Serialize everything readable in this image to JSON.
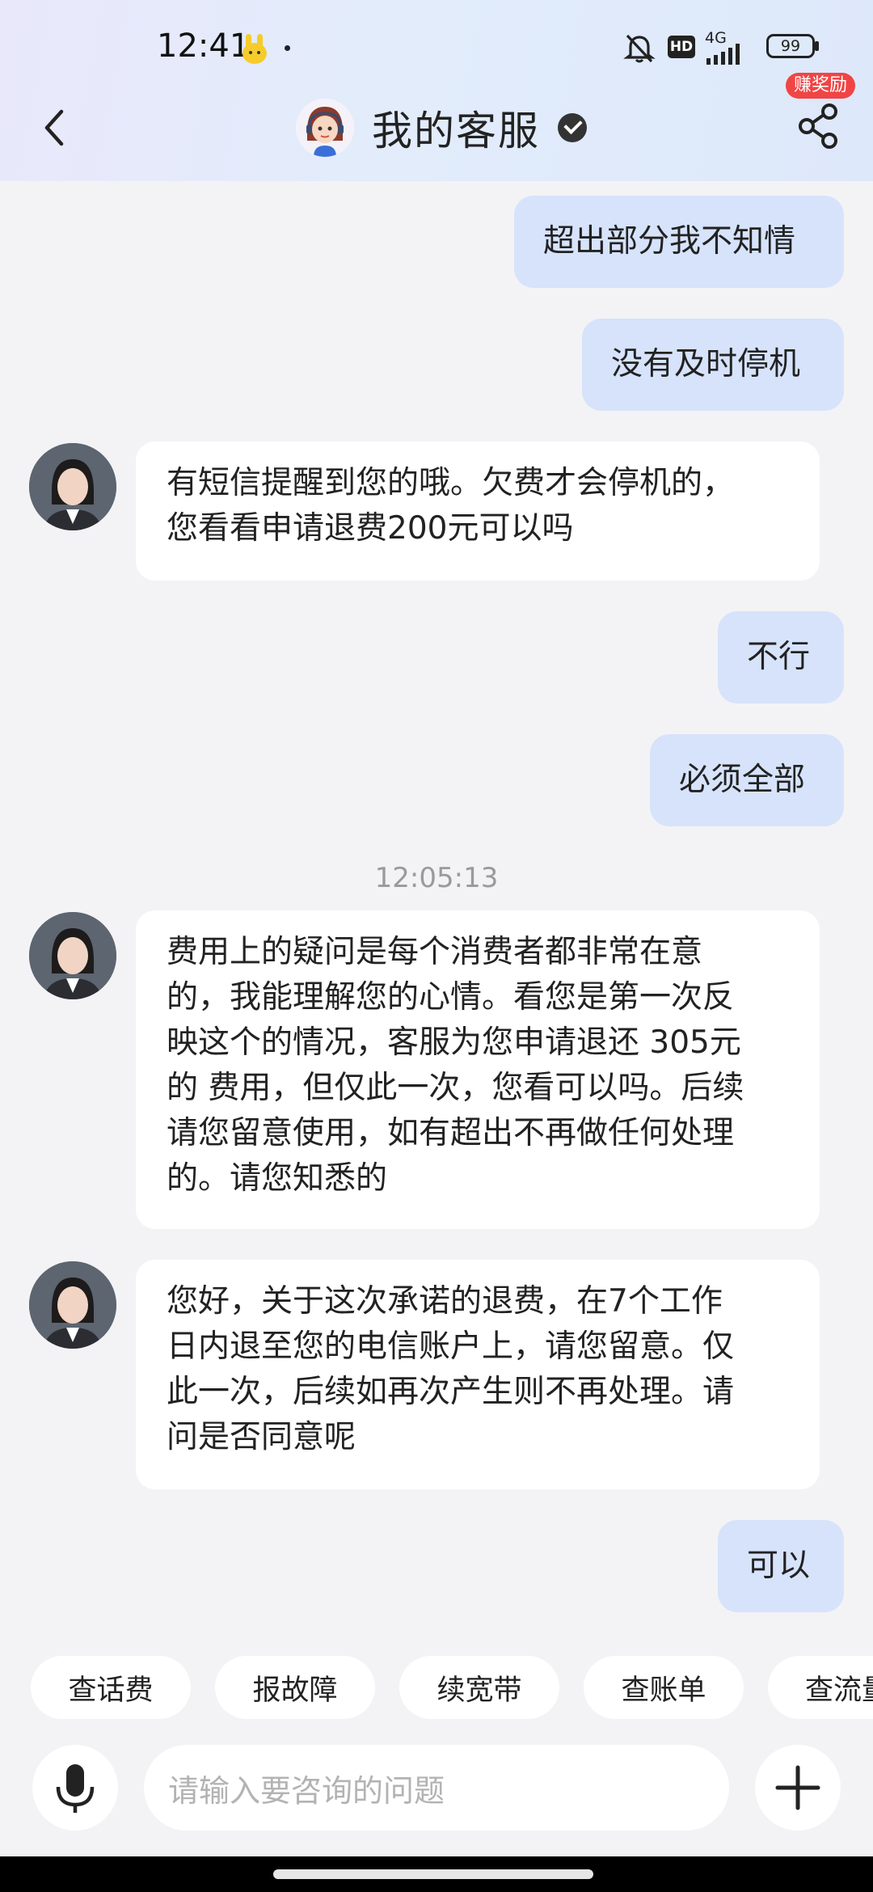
{
  "status_bar": {
    "time": "12:41",
    "network": "4G",
    "hd": "HD",
    "battery": "99"
  },
  "header": {
    "title": "我的客服",
    "reward_badge": "赚奖励"
  },
  "messages": [
    {
      "from": "user",
      "text": "超出部分我不知情"
    },
    {
      "from": "user",
      "text": "没有及时停机"
    },
    {
      "from": "agent",
      "lines": [
        "有短信提醒到您的哦。欠费才会停机的，",
        "您看看申请退费200元可以吗"
      ]
    },
    {
      "from": "user",
      "text": "不行"
    },
    {
      "from": "user",
      "text": "必须全部"
    },
    {
      "timestamp": "12:05:13"
    },
    {
      "from": "agent",
      "lines": [
        "费用上的疑问是每个消费者都非常在意",
        "的，我能理解您的心情。看您是第一次反",
        "映这个的情况，客服为您申请退还 305元",
        "的 费用，但仅此一次，您看可以吗。后续",
        "请您留意使用，如有超出不再做任何处理",
        "的。请您知悉的"
      ]
    },
    {
      "from": "agent",
      "lines": [
        "您好，关于这次承诺的退费，在7个工作",
        "日内退至您的电信账户上，请您留意。仅",
        "此一次，后续如再次产生则不再处理。请",
        "问是否同意呢"
      ]
    },
    {
      "from": "user",
      "text": "可以"
    }
  ],
  "quick_chips": [
    "查话费",
    "报故障",
    "续宽带",
    "查账单",
    "查流量"
  ],
  "input": {
    "placeholder": "请输入要咨询的问题"
  }
}
